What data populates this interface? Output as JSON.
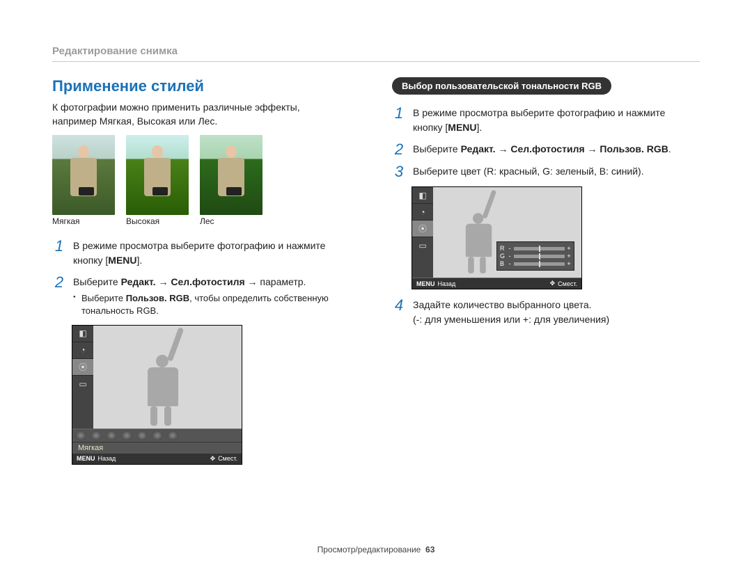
{
  "header": "Редактирование снимка",
  "left": {
    "title": "Применение стилей",
    "intro1": "К фотографии можно применить различные эффекты,",
    "intro2": "например Мягкая, Высокая или Лес.",
    "caps": {
      "soft": "Мягкая",
      "high": "Высокая",
      "forest": "Лес"
    },
    "step1a": "В режиме просмотра выберите фотографию и нажмите",
    "step1b_prefix": "кнопку [",
    "step1b_button": "MENU",
    "step1b_suffix": "].",
    "step2_plain": "Выберите ",
    "step2_bold": "Редакт. → Сел.фотостиля",
    "step2_tail": " → параметр.",
    "bullet_prefix": "Выберите ",
    "bullet_bold": "Пользов. RGB",
    "bullet_tail": ", чтобы определить собственную тональность RGB."
  },
  "right": {
    "pill": "Выбор пользовательской тональности RGB",
    "step1a": "В режиме просмотра выберите фотографию и нажмите",
    "step1b_prefix": "кнопку [",
    "step1b_button": "MENU",
    "step1b_suffix": "].",
    "step2_plain": "Выберите ",
    "step2_bold": "Редакт. → Сел.фотостиля → Пользов. RGB",
    "step2_tail": ".",
    "step3": "Выберите цвет (R: красный, G: зеленый, B: синий).",
    "step4a": "Задайте количество выбранного цвета.",
    "step4b": "(-: для уменьшения или +: для увеличения)"
  },
  "lcd": {
    "style_label": "Мягкая",
    "menu": "MENU",
    "back": "Назад",
    "move": "Смест.",
    "rgb": {
      "r": "R",
      "g": "G",
      "b": "B",
      "minus": "-",
      "plus": "+"
    }
  },
  "footer": {
    "label": "Просмотр/редактирование",
    "page": "63"
  }
}
